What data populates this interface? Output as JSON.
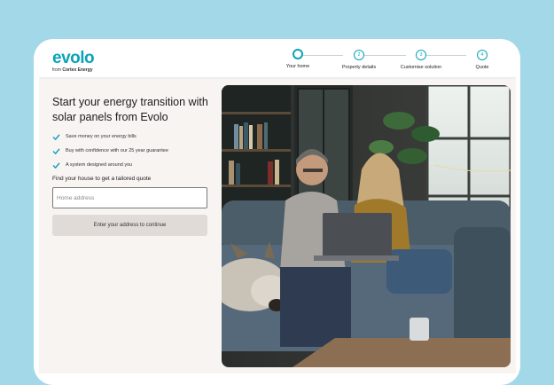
{
  "brand": {
    "name": "evolo",
    "sub_prefix": "from",
    "sub_company": "Cortex Energy"
  },
  "stepper": {
    "steps": [
      {
        "number": "",
        "label": "Your home",
        "active": true
      },
      {
        "number": "2",
        "label": "Property details",
        "active": false
      },
      {
        "number": "3",
        "label": "Customise solution",
        "active": false
      },
      {
        "number": "4",
        "label": "Quote",
        "active": false
      }
    ]
  },
  "hero": {
    "title_line1": "Start your energy transition with",
    "title_line2": "solar panels from Evolo",
    "benefits": [
      "Save money on your energy bills",
      "Buy with confidence with our 25 year guarantee",
      "A system designed around you"
    ]
  },
  "form": {
    "label": "Find your house to get a tailored quote",
    "address_placeholder": "Home address",
    "address_value": "",
    "continue_label": "Enter your address to continue"
  },
  "colors": {
    "accent": "#0aa3b8",
    "backdrop": "#a3d8e8",
    "button_disabled": "#e1dbd8"
  },
  "icons": {
    "benefit": "check-icon"
  }
}
